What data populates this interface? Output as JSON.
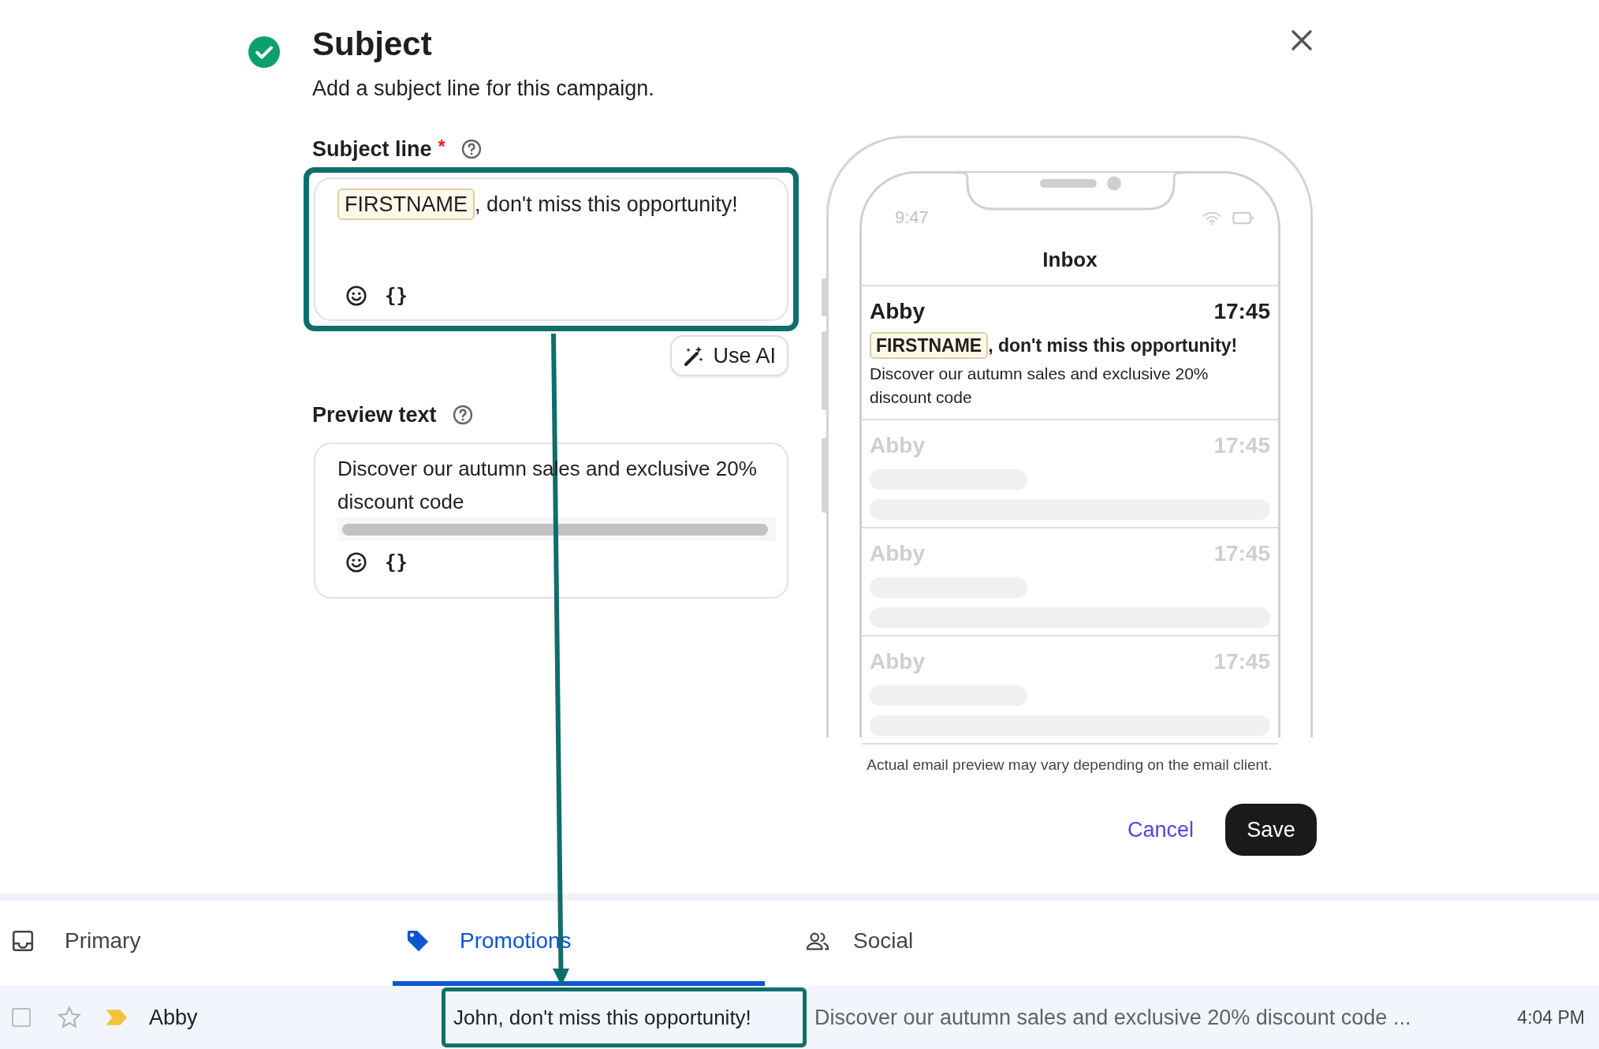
{
  "header": {
    "title": "Subject",
    "subtitle": "Add a subject line for this campaign.",
    "completed": true
  },
  "subject_field": {
    "label": "Subject line",
    "required_mark": "*",
    "token": "FIRSTNAME",
    "value": ", don't miss this opportunity!",
    "variable_button": "{}",
    "highlighted": true
  },
  "use_ai_button": {
    "label": "Use AI"
  },
  "preview_field": {
    "label": "Preview text",
    "value": "Discover our autumn sales and exclusive 20% discount code",
    "variable_button": "{}"
  },
  "phone": {
    "time": "9:47",
    "title": "Inbox",
    "emails": [
      {
        "sender": "Abby",
        "time": "17:45",
        "token": "FIRSTNAME",
        "subject": ", don't miss this opportunity!",
        "preview": "Discover our autumn sales and exclusive 20% discount code",
        "faded": false
      },
      {
        "sender": "Abby",
        "time": "17:45",
        "faded": true
      },
      {
        "sender": "Abby",
        "time": "17:45",
        "faded": true
      },
      {
        "sender": "Abby",
        "time": "17:45",
        "faded": true
      }
    ]
  },
  "caption": "Actual email preview may vary depending on the email client.",
  "actions": {
    "cancel": "Cancel",
    "save": "Save"
  },
  "inbox": {
    "tabs": [
      {
        "label": "Primary",
        "selected": false
      },
      {
        "label": "Promotions",
        "selected": true
      },
      {
        "label": "Social",
        "selected": false
      }
    ],
    "rows": [
      {
        "checked": false,
        "starred": false,
        "important": true,
        "sender": "Abby",
        "subject": "John, don't miss this opportunity!",
        "snippet": "Discover our autumn sales and exclusive 20% discount code ...",
        "time": "4:04 PM",
        "highlighted": true
      }
    ]
  }
}
